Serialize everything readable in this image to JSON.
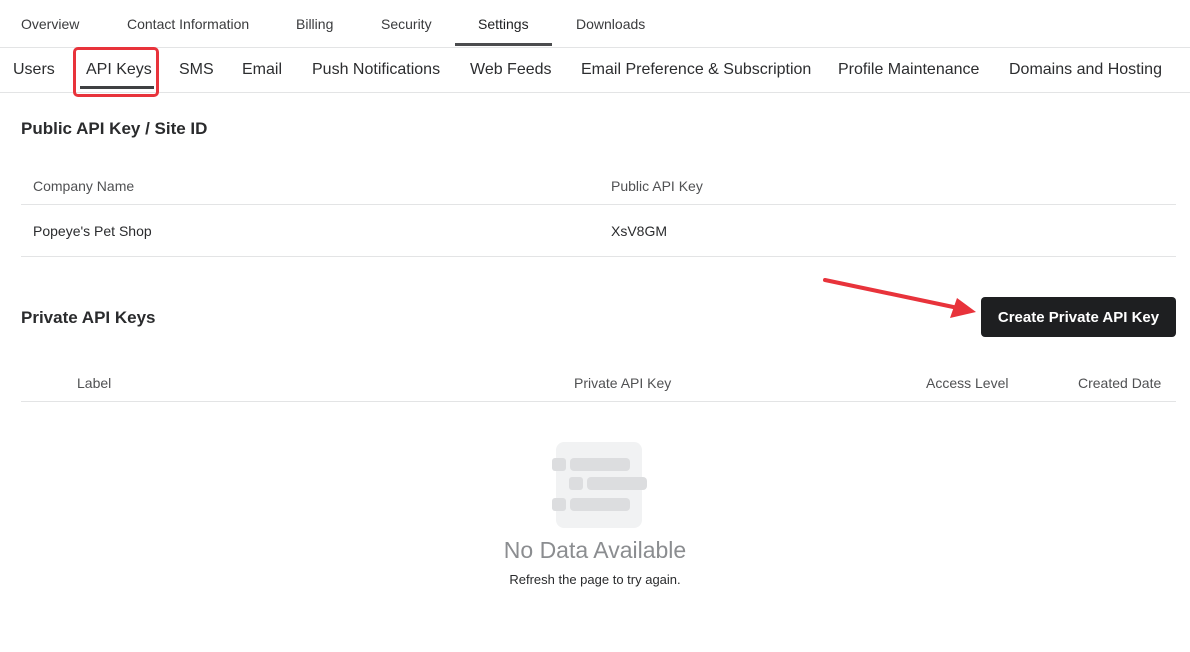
{
  "top_tabs": {
    "overview": "Overview",
    "contact": "Contact Information",
    "billing": "Billing",
    "security": "Security",
    "settings": "Settings",
    "downloads": "Downloads",
    "active": "Settings"
  },
  "sub_tabs": {
    "users": "Users",
    "api_keys": "API Keys",
    "sms": "SMS",
    "email": "Email",
    "push": "Push Notifications",
    "web_feeds": "Web Feeds",
    "email_pref": "Email Preference & Subscription",
    "profile": "Profile Maintenance",
    "domains": "Domains and Hosting",
    "active": "API Keys"
  },
  "public_section": {
    "title": "Public API Key / Site ID",
    "headers": [
      "Company Name",
      "Public API Key"
    ],
    "rows": [
      [
        "Popeye's Pet Shop",
        "XsV8GM"
      ]
    ]
  },
  "private_section": {
    "title": "Private API Keys",
    "create_button": "Create Private API Key",
    "headers": [
      "Label",
      "Private API Key",
      "Access Level",
      "Created Date"
    ],
    "empty_title": "No Data Available",
    "empty_subtitle": "Refresh the page to try again."
  },
  "colors": {
    "annotation": "#e8333b",
    "button_bg": "#1e1f21",
    "active_underline": "#4b4c4e"
  },
  "icons": {
    "empty_state": "empty-list-icon",
    "annotation_arrow": "arrow-right-icon"
  }
}
